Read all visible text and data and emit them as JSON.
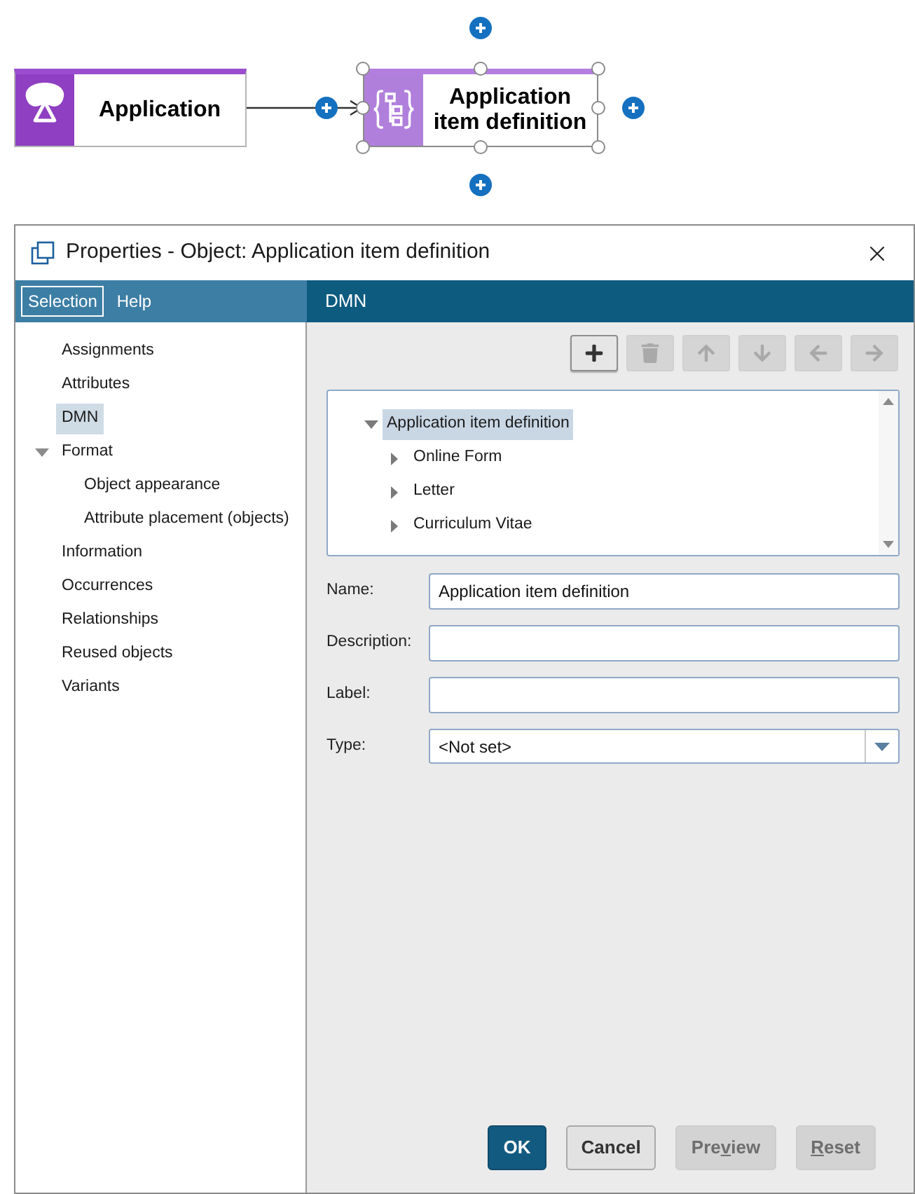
{
  "diagram": {
    "nodes": [
      {
        "kind": "application",
        "label": "Application",
        "selected": false
      },
      {
        "kind": "item_definition",
        "label": "Application item definition",
        "selected": true
      }
    ]
  },
  "window": {
    "title": "Properties - Object: Application item definition"
  },
  "nav": {
    "tabs": [
      {
        "label": "Selection",
        "selected": true
      },
      {
        "label": "Help",
        "selected": false
      }
    ],
    "items": [
      {
        "label": "Assignments",
        "selected": false
      },
      {
        "label": "Attributes",
        "selected": false
      },
      {
        "label": "DMN",
        "selected": true
      },
      {
        "label": "Format",
        "selected": false,
        "expanded": true,
        "children": [
          {
            "label": "Object appearance",
            "selected": false
          },
          {
            "label": "Attribute placement (objects)",
            "selected": false
          }
        ]
      },
      {
        "label": "Information",
        "selected": false
      },
      {
        "label": "Occurrences",
        "selected": false
      },
      {
        "label": "Relationships",
        "selected": false
      },
      {
        "label": "Reused objects",
        "selected": false
      },
      {
        "label": "Variants",
        "selected": false
      }
    ]
  },
  "panel": {
    "title": "DMN",
    "toolbar": [
      {
        "kind": "add",
        "disabled": false
      },
      {
        "kind": "delete",
        "disabled": true
      },
      {
        "kind": "up",
        "disabled": true
      },
      {
        "kind": "down",
        "disabled": true
      },
      {
        "kind": "left",
        "disabled": true
      },
      {
        "kind": "right",
        "disabled": true
      }
    ],
    "tree": [
      {
        "label": "Application item definition",
        "selected": true,
        "expanded": true,
        "children": [
          {
            "label": "Online Form",
            "selected": false,
            "expanded": false
          },
          {
            "label": "Letter",
            "selected": false,
            "expanded": false
          },
          {
            "label": "Curriculum Vitae",
            "selected": false,
            "expanded": false
          }
        ]
      }
    ],
    "fields": [
      {
        "kind": "text",
        "label": "Name:",
        "value": "Application item definition"
      },
      {
        "kind": "text",
        "label": "Description:"
      },
      {
        "kind": "text",
        "label": "Label:"
      },
      {
        "kind": "select",
        "label": "Type:",
        "value": "<Not set>"
      }
    ]
  },
  "buttons": [
    {
      "kind": "ok",
      "disabled": false,
      "label_parts": [
        {
          "text": "OK",
          "underlined": false
        }
      ]
    },
    {
      "kind": "cancel",
      "disabled": false,
      "label_parts": [
        {
          "text": "Cancel",
          "underlined": false
        }
      ]
    },
    {
      "kind": "preview",
      "disabled": true,
      "label_parts": [
        {
          "text": "Pre",
          "underlined": false
        },
        {
          "text": "v",
          "underlined": true
        },
        {
          "text": "iew",
          "underlined": false
        }
      ]
    },
    {
      "kind": "reset",
      "disabled": true,
      "label_parts": [
        {
          "text": "R",
          "underlined": true
        },
        {
          "text": "eset",
          "underlined": false
        }
      ]
    }
  ]
}
